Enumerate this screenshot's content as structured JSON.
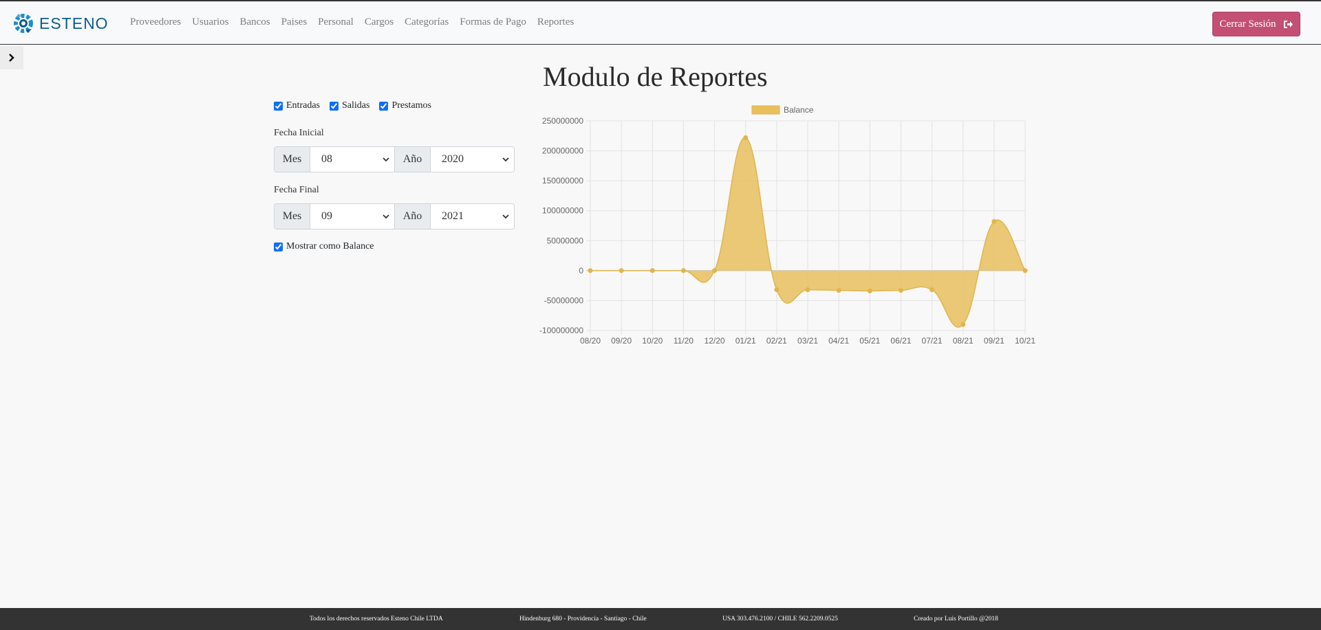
{
  "brand": {
    "name": "ESTENO"
  },
  "nav": {
    "items": [
      "Proveedores",
      "Usuarios",
      "Bancos",
      "Paises",
      "Personal",
      "Cargos",
      "Categorías",
      "Formas de Pago",
      "Reportes"
    ]
  },
  "logout": {
    "label": "Cerrar Sesión",
    "icon": "sign-out-icon"
  },
  "sidebar_toggle": {
    "icon": "chevron-right-icon"
  },
  "page": {
    "title": "Modulo de Reportes"
  },
  "filters": {
    "checkboxes": [
      {
        "label": "Entradas",
        "checked": true
      },
      {
        "label": "Salidas",
        "checked": true
      },
      {
        "label": "Prestamos",
        "checked": true
      }
    ],
    "fecha_inicial": {
      "label": "Fecha Inicial",
      "mes_label": "Mes",
      "mes_value": "08",
      "anio_label": "Año",
      "anio_value": "2020"
    },
    "fecha_final": {
      "label": "Fecha Final",
      "mes_label": "Mes",
      "mes_value": "09",
      "anio_label": "Año",
      "anio_value": "2021"
    },
    "balance": {
      "label": "Mostrar como Balance",
      "checked": true
    }
  },
  "chart_data": {
    "type": "area",
    "categories": [
      "08/20",
      "09/20",
      "10/20",
      "11/20",
      "12/20",
      "01/21",
      "02/21",
      "03/21",
      "04/21",
      "05/21",
      "06/21",
      "07/21",
      "08/21",
      "09/21",
      "10/21"
    ],
    "series": [
      {
        "name": "Balance",
        "values": [
          0,
          0,
          0,
          0,
          0,
          222000000,
          -32000000,
          -32000000,
          -33000000,
          -34000000,
          -33000000,
          -32000000,
          -90000000,
          82000000,
          0
        ],
        "color": "#e8c05e"
      }
    ],
    "yticks": [
      "250000000",
      "200000000",
      "150000000",
      "100000000",
      "50000000",
      "0",
      "-50000000",
      "-100000000"
    ],
    "ylim": [
      -100000000,
      250000000
    ],
    "grid": true,
    "legend": "top"
  },
  "footer": {
    "rights": "Todos los derechos reservados Esteno Chile LTDA",
    "address": "Hindenburg 680 - Providencia - Santiago - Chile",
    "phones": "USA 303.476.2100 / CHILE 562.2209.0525",
    "credit": "Creado por Luis Portillo @2018"
  }
}
